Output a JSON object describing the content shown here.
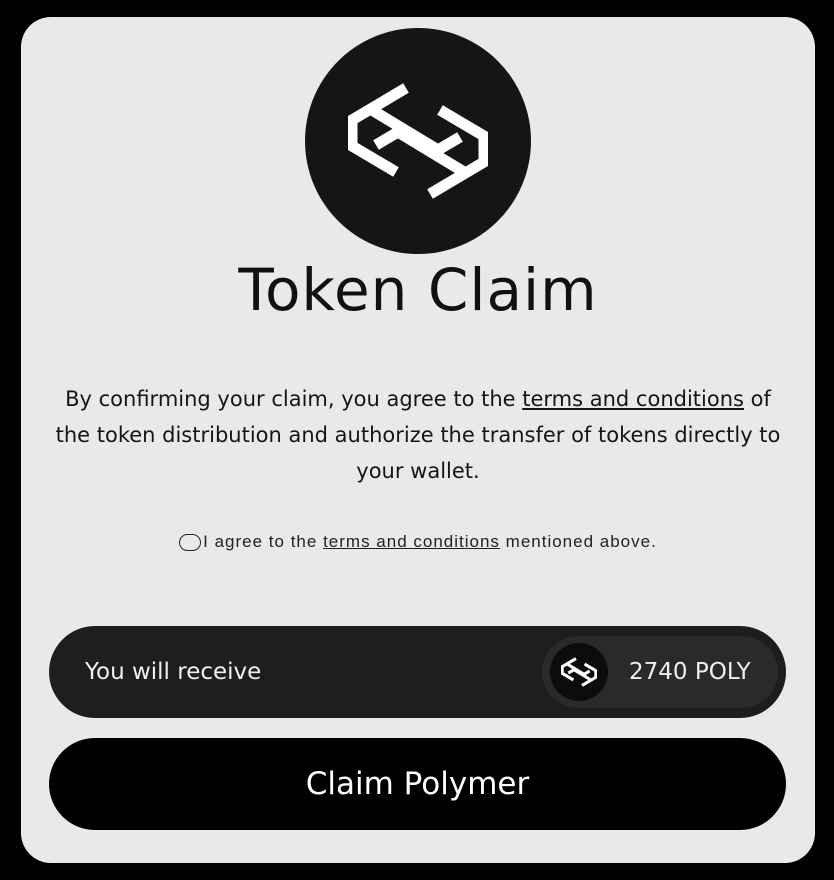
{
  "header": {
    "title": "Token Claim",
    "logo_icon": "polymer-logo-icon"
  },
  "description": {
    "prefix": "By confirming your claim, you agree to the ",
    "link_text": "terms and conditions",
    "suffix": " of the token distribution and authorize the transfer of tokens directly to your wallet."
  },
  "agreement": {
    "prefix": "I agree to the ",
    "link_text": "terms and conditions",
    "suffix": " mentioned above.",
    "checked": false
  },
  "receive": {
    "label": "You will receive",
    "amount": "2740 POLY",
    "token_icon": "polymer-token-icon"
  },
  "claim_button": {
    "label": "Claim Polymer"
  },
  "colors": {
    "page_background": "#000000",
    "card_background": "#e9e9e9",
    "receive_bar": "#1e1e1e",
    "button": "#000000"
  }
}
